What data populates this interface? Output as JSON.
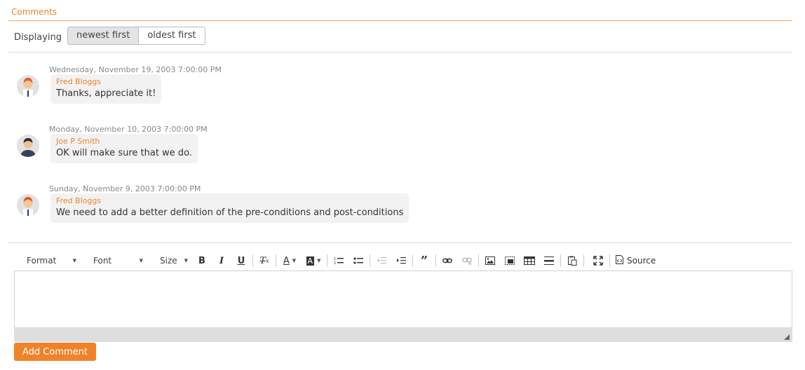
{
  "section": {
    "title": "Comments"
  },
  "sort": {
    "label": "Displaying",
    "options": [
      {
        "label": "newest first",
        "selected": true
      },
      {
        "label": "oldest first",
        "selected": false
      }
    ]
  },
  "comments": [
    {
      "date": "Wednesday, November 19, 2003 7:00:00 PM",
      "author": "Fred Bloggs",
      "text": "Thanks, appreciate it!",
      "avatar": "fred-avatar-icon"
    },
    {
      "date": "Monday, November 10, 2003 7:00:00 PM",
      "author": "Joe P Smith",
      "text": "OK will make sure that we do.",
      "avatar": "joe-avatar-icon"
    },
    {
      "date": "Sunday, November 9, 2003 7:00:00 PM",
      "author": "Fred Bloggs",
      "text": "We need to add a better definition of the pre-conditions and post-conditions",
      "avatar": "fred-avatar-icon"
    }
  ],
  "editor": {
    "format_label": "Format",
    "font_label": "Font",
    "size_label": "Size",
    "source_label": "Source",
    "icons": [
      "bold-icon",
      "italic-icon",
      "underline-icon",
      "remove-format-icon",
      "text-color-icon",
      "background-color-icon",
      "numbered-list-icon",
      "bulleted-list-icon",
      "outdent-icon",
      "indent-icon",
      "blockquote-icon",
      "link-icon",
      "unlink-icon",
      "image-icon",
      "iframe-icon",
      "table-icon",
      "horizontal-line-icon",
      "paste-icon",
      "maximize-icon",
      "source-icon"
    ]
  },
  "submit": {
    "label": "Add Comment"
  },
  "colors": {
    "accent": "#f0832a",
    "bubble": "#f2f2f2",
    "editor_footer": "#dedede"
  }
}
